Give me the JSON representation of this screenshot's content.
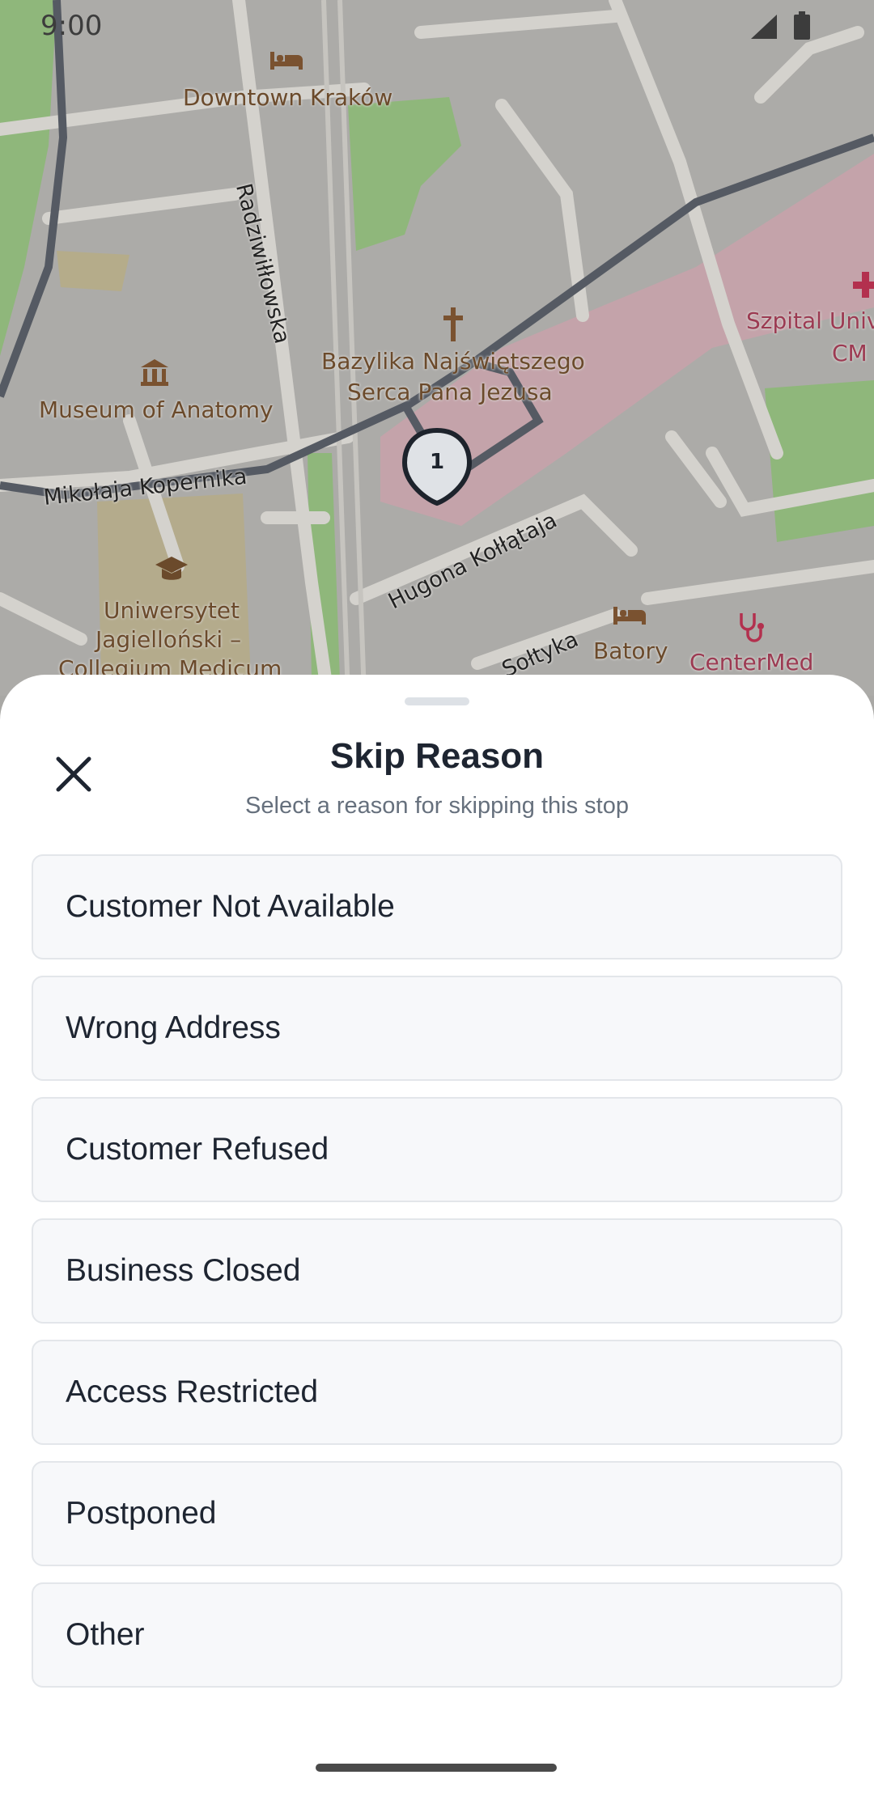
{
  "status_bar": {
    "time": "9:00"
  },
  "map": {
    "places": {
      "downtown": "Downtown Kraków",
      "museum": "Museum of Anatomy",
      "basilica_line1": "Bazylika Najświętszego",
      "basilica_line2": "Serca Pana Jezusa",
      "university_line1": "Uniwersytet",
      "university_line2": "Jagielloński –",
      "university_line3": "Collegium Medicum",
      "hospital_line1": "Szpital Univ",
      "hospital_line2": "CM",
      "batory": "Batory",
      "centermed": "CenterMed"
    },
    "streets": {
      "radziwillowska": "Radziwiłłowska",
      "kopernika": "Mikołaja Kopernika",
      "kollataja": "Hugona Kołłątaja",
      "soltyka": "Sołtyka"
    },
    "stop_marker": {
      "number": "1"
    }
  },
  "sheet": {
    "title": "Skip Reason",
    "subtitle": "Select a reason for skipping this stop",
    "reasons": [
      "Customer Not Available",
      "Wrong Address",
      "Customer Refused",
      "Business Closed",
      "Access Restricted",
      "Postponed",
      "Other"
    ]
  },
  "icons": {
    "close": "close-icon",
    "signal": "signal-icon",
    "battery": "battery-icon",
    "hotel": "bed-icon",
    "museum": "museum-icon",
    "church": "cross-icon",
    "university": "graduation-cap-icon",
    "hospital": "plus-icon",
    "clinic": "stethoscope-icon"
  },
  "colors": {
    "map_background": "#acaba8",
    "park": "#8fb77b",
    "hospital_area": "#c4a3aa",
    "route": "#555a63",
    "accent_text": "#1e2531"
  }
}
